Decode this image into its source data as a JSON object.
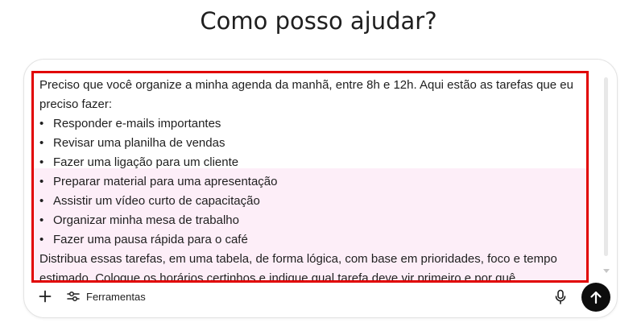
{
  "heading": "Como posso ajudar?",
  "composer": {
    "intro_line_1": "Preciso que você organize a minha agenda da manhã, entre 8h e 12h. Aqui estão as tarefas que eu",
    "intro_line_2": "preciso fazer:",
    "tasks": [
      "Responder e-mails importantes",
      "Revisar uma planilha de vendas",
      "Fazer uma ligação para um cliente",
      "Preparar material para uma apresentação",
      "Assistir um vídeo curto de capacitação",
      "Organizar minha mesa de trabalho",
      "Fazer uma pausa rápida para o café"
    ],
    "outro_line_1": "Distribua essas tarefas, em uma tabela, de forma lógica, com base em prioridades, foco e tempo",
    "outro_line_2": "estimado. Coloque os horários certinhos e indique qual tarefa deve vir primeiro e por quê.",
    "bullet_glyph": "•"
  },
  "toolbar": {
    "tools_label": "Ferramentas",
    "icons": {
      "add": "plus-icon",
      "tools": "sliders-icon",
      "mic": "microphone-icon",
      "send": "arrow-up-icon"
    }
  },
  "colors": {
    "annotation_border": "#e10000",
    "highlight": "#fdeef8",
    "send_button": "#0d0d0d"
  }
}
